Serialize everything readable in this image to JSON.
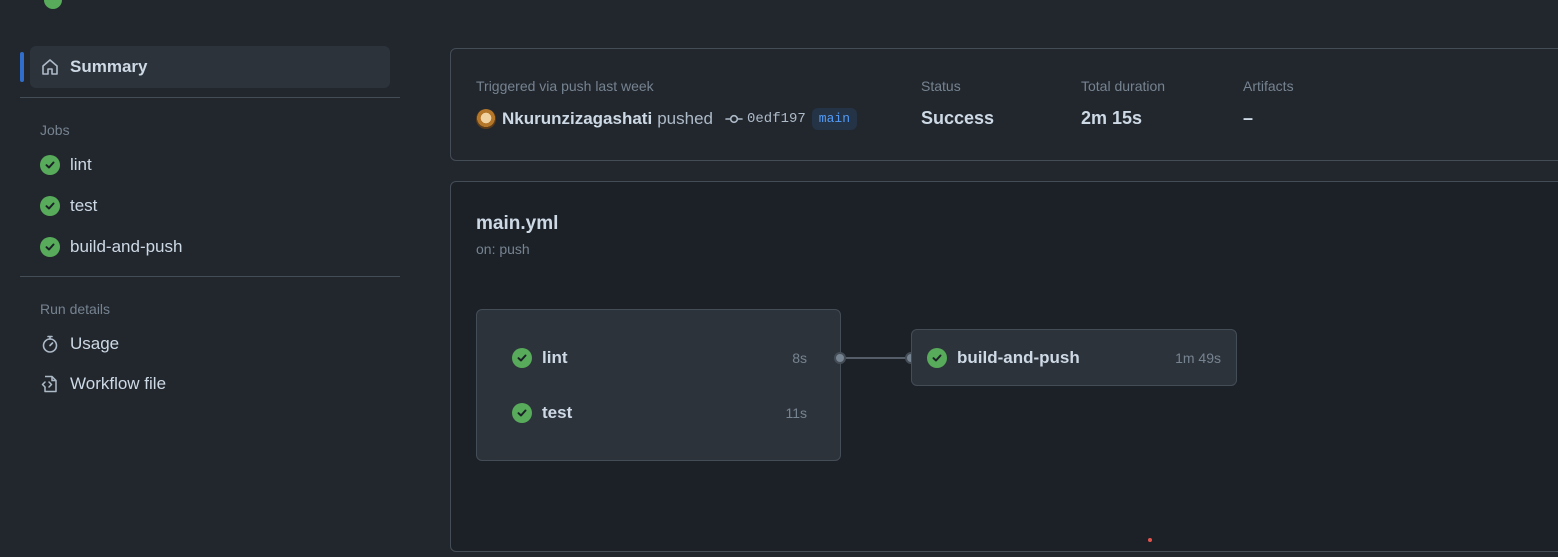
{
  "sidebar": {
    "summary_label": "Summary",
    "jobs_title": "Jobs",
    "jobs": [
      {
        "label": "lint"
      },
      {
        "label": "test"
      },
      {
        "label": "build-and-push"
      }
    ],
    "run_details_title": "Run details",
    "details": [
      {
        "label": "Usage",
        "icon": "stopwatch-icon"
      },
      {
        "label": "Workflow file",
        "icon": "file-code-icon"
      }
    ]
  },
  "run_info": {
    "trigger_text": "Triggered via push last week",
    "user": "Nkurunzizagashati",
    "action": "pushed",
    "commit_sha": "0edf197",
    "branch": "main",
    "status_label": "Status",
    "status_value": "Success",
    "duration_label": "Total duration",
    "duration_value": "2m 15s",
    "artifacts_label": "Artifacts",
    "artifacts_value": "–"
  },
  "workflow": {
    "file_name": "main.yml",
    "trigger": "on: push",
    "group_jobs": [
      {
        "name": "lint",
        "duration": "8s",
        "status": "success"
      },
      {
        "name": "test",
        "duration": "11s",
        "status": "success"
      }
    ],
    "downstream_job": {
      "name": "build-and-push",
      "duration": "1m 49s",
      "status": "success"
    }
  },
  "colors": {
    "success": "#57ab5a",
    "accent": "#316dca",
    "background": "#22272e"
  }
}
